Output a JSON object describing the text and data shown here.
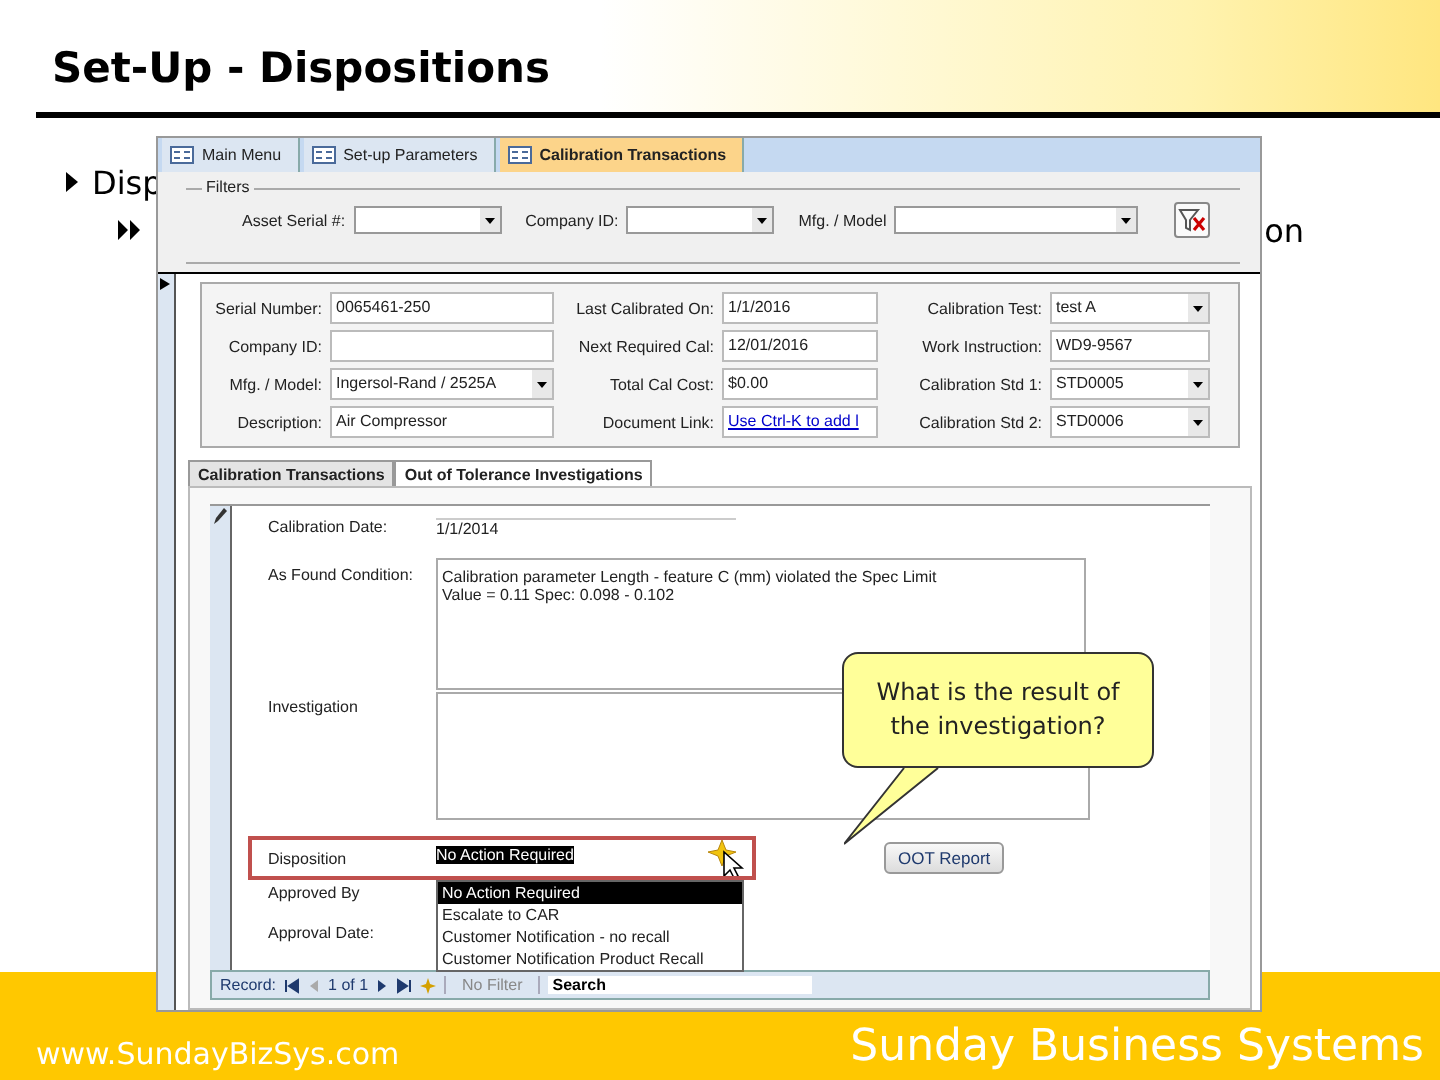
{
  "slide": {
    "title": "Set-Up - Dispositions",
    "bullets": [
      {
        "kind": "arrow",
        "text": "Disp"
      },
      {
        "kind": "double",
        "text": "on"
      }
    ],
    "footer": {
      "website": "www.SundayBizSys.com",
      "company": "Sunday Business Systems"
    }
  },
  "window": {
    "tabs": [
      {
        "label": "Main Menu",
        "selected": false
      },
      {
        "label": "Set-up Parameters",
        "selected": false
      },
      {
        "label": "Calibration Transactions",
        "selected": true
      }
    ],
    "filters": {
      "title": "Filters",
      "fields": [
        {
          "label": "Asset Serial #:",
          "kind": "combo"
        },
        {
          "label": "Company ID:",
          "kind": "combo"
        },
        {
          "label": "Mfg. / Model",
          "kind": "wide"
        }
      ]
    },
    "record": [
      {
        "label": "Serial Number:",
        "value": "0065461-250",
        "kind": "text"
      },
      {
        "label": "Last Calibrated On:",
        "value": "1/1/2016",
        "kind": "text"
      },
      {
        "label": "Calibration Test:",
        "value": "test A",
        "kind": "combo"
      },
      {
        "label": "Company ID:",
        "kind": "text"
      },
      {
        "label": "Next Required Cal:",
        "value": "12/01/2016",
        "kind": "text"
      },
      {
        "label": "Work Instruction:",
        "value": "WD9-9567",
        "kind": "text"
      },
      {
        "label": "Mfg. / Model:",
        "value": "Ingersol-Rand / 2525A",
        "kind": "combo"
      },
      {
        "label": "Total Cal Cost:",
        "value": "$0.00",
        "kind": "text"
      },
      {
        "label": "Calibration Std 1:",
        "value": "STD0005",
        "kind": "combo"
      },
      {
        "label": "Description:",
        "value": "Air Compressor",
        "kind": "text"
      },
      {
        "label": "Document Link:",
        "value": "Use Ctrl-K to add l",
        "kind": "link"
      },
      {
        "label": "Calibration Std 2:",
        "value": "STD0006",
        "kind": "combo"
      }
    ],
    "subtabs": [
      {
        "label": "Calibration Transactions",
        "selected": false
      },
      {
        "label": "Out of Tolerance Investigations",
        "selected": true
      }
    ],
    "subform": {
      "calibration_date": {
        "label": "Calibration Date:",
        "value": "1/1/2014"
      },
      "as_found": {
        "label": "As Found Condition:",
        "lines": [
          "Calibration parameter Length - feature C (mm) violated the Spec Limit",
          "Value = 0.11     Spec: 0.098 - 0.102"
        ]
      },
      "investigation": {
        "label": "Investigation"
      },
      "disposition": {
        "label": "Disposition",
        "value": "No Action Required",
        "options": [
          {
            "label": "No Action Required",
            "selected": true
          },
          {
            "label": "Escalate to CAR",
            "selected": false
          },
          {
            "label": "Customer Notification - no recall",
            "selected": false
          },
          {
            "label": "Customer Notification   Product Recall",
            "selected": false
          }
        ]
      },
      "approved_by": {
        "label": "Approved By"
      },
      "approval_date": {
        "label": "Approval Date:"
      },
      "button": "OOT Report",
      "nav": {
        "label": "Record:",
        "position": "1 of 1",
        "filter": "No Filter",
        "search": "Search"
      }
    },
    "callout": "What is the result of the investigation?"
  }
}
